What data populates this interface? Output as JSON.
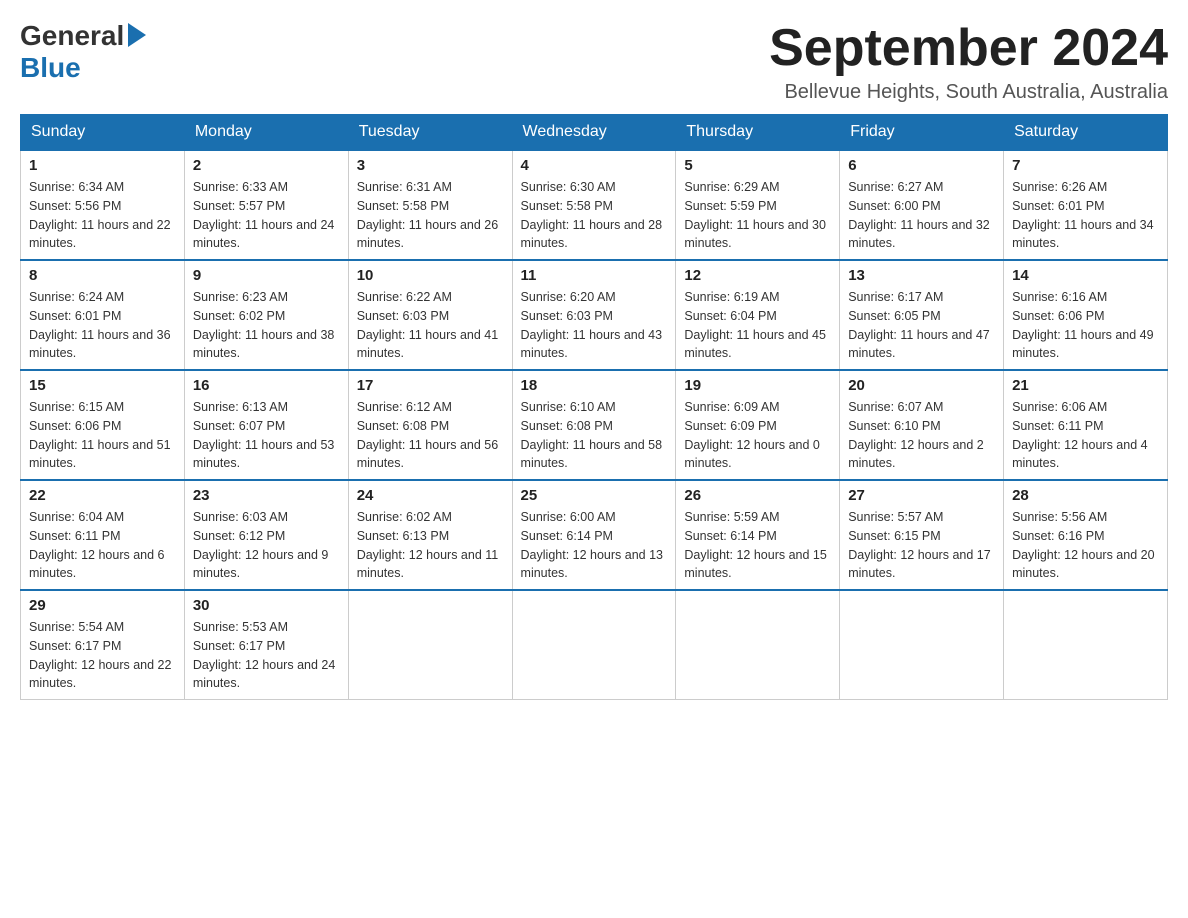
{
  "logo": {
    "general": "General",
    "blue": "Blue"
  },
  "header": {
    "month": "September 2024",
    "location": "Bellevue Heights, South Australia, Australia"
  },
  "weekdays": [
    "Sunday",
    "Monday",
    "Tuesday",
    "Wednesday",
    "Thursday",
    "Friday",
    "Saturday"
  ],
  "weeks": [
    [
      {
        "day": "1",
        "sunrise": "6:34 AM",
        "sunset": "5:56 PM",
        "daylight": "11 hours and 22 minutes."
      },
      {
        "day": "2",
        "sunrise": "6:33 AM",
        "sunset": "5:57 PM",
        "daylight": "11 hours and 24 minutes."
      },
      {
        "day": "3",
        "sunrise": "6:31 AM",
        "sunset": "5:58 PM",
        "daylight": "11 hours and 26 minutes."
      },
      {
        "day": "4",
        "sunrise": "6:30 AM",
        "sunset": "5:58 PM",
        "daylight": "11 hours and 28 minutes."
      },
      {
        "day": "5",
        "sunrise": "6:29 AM",
        "sunset": "5:59 PM",
        "daylight": "11 hours and 30 minutes."
      },
      {
        "day": "6",
        "sunrise": "6:27 AM",
        "sunset": "6:00 PM",
        "daylight": "11 hours and 32 minutes."
      },
      {
        "day": "7",
        "sunrise": "6:26 AM",
        "sunset": "6:01 PM",
        "daylight": "11 hours and 34 minutes."
      }
    ],
    [
      {
        "day": "8",
        "sunrise": "6:24 AM",
        "sunset": "6:01 PM",
        "daylight": "11 hours and 36 minutes."
      },
      {
        "day": "9",
        "sunrise": "6:23 AM",
        "sunset": "6:02 PM",
        "daylight": "11 hours and 38 minutes."
      },
      {
        "day": "10",
        "sunrise": "6:22 AM",
        "sunset": "6:03 PM",
        "daylight": "11 hours and 41 minutes."
      },
      {
        "day": "11",
        "sunrise": "6:20 AM",
        "sunset": "6:03 PM",
        "daylight": "11 hours and 43 minutes."
      },
      {
        "day": "12",
        "sunrise": "6:19 AM",
        "sunset": "6:04 PM",
        "daylight": "11 hours and 45 minutes."
      },
      {
        "day": "13",
        "sunrise": "6:17 AM",
        "sunset": "6:05 PM",
        "daylight": "11 hours and 47 minutes."
      },
      {
        "day": "14",
        "sunrise": "6:16 AM",
        "sunset": "6:06 PM",
        "daylight": "11 hours and 49 minutes."
      }
    ],
    [
      {
        "day": "15",
        "sunrise": "6:15 AM",
        "sunset": "6:06 PM",
        "daylight": "11 hours and 51 minutes."
      },
      {
        "day": "16",
        "sunrise": "6:13 AM",
        "sunset": "6:07 PM",
        "daylight": "11 hours and 53 minutes."
      },
      {
        "day": "17",
        "sunrise": "6:12 AM",
        "sunset": "6:08 PM",
        "daylight": "11 hours and 56 minutes."
      },
      {
        "day": "18",
        "sunrise": "6:10 AM",
        "sunset": "6:08 PM",
        "daylight": "11 hours and 58 minutes."
      },
      {
        "day": "19",
        "sunrise": "6:09 AM",
        "sunset": "6:09 PM",
        "daylight": "12 hours and 0 minutes."
      },
      {
        "day": "20",
        "sunrise": "6:07 AM",
        "sunset": "6:10 PM",
        "daylight": "12 hours and 2 minutes."
      },
      {
        "day": "21",
        "sunrise": "6:06 AM",
        "sunset": "6:11 PM",
        "daylight": "12 hours and 4 minutes."
      }
    ],
    [
      {
        "day": "22",
        "sunrise": "6:04 AM",
        "sunset": "6:11 PM",
        "daylight": "12 hours and 6 minutes."
      },
      {
        "day": "23",
        "sunrise": "6:03 AM",
        "sunset": "6:12 PM",
        "daylight": "12 hours and 9 minutes."
      },
      {
        "day": "24",
        "sunrise": "6:02 AM",
        "sunset": "6:13 PM",
        "daylight": "12 hours and 11 minutes."
      },
      {
        "day": "25",
        "sunrise": "6:00 AM",
        "sunset": "6:14 PM",
        "daylight": "12 hours and 13 minutes."
      },
      {
        "day": "26",
        "sunrise": "5:59 AM",
        "sunset": "6:14 PM",
        "daylight": "12 hours and 15 minutes."
      },
      {
        "day": "27",
        "sunrise": "5:57 AM",
        "sunset": "6:15 PM",
        "daylight": "12 hours and 17 minutes."
      },
      {
        "day": "28",
        "sunrise": "5:56 AM",
        "sunset": "6:16 PM",
        "daylight": "12 hours and 20 minutes."
      }
    ],
    [
      {
        "day": "29",
        "sunrise": "5:54 AM",
        "sunset": "6:17 PM",
        "daylight": "12 hours and 22 minutes."
      },
      {
        "day": "30",
        "sunrise": "5:53 AM",
        "sunset": "6:17 PM",
        "daylight": "12 hours and 24 minutes."
      },
      null,
      null,
      null,
      null,
      null
    ]
  ],
  "labels": {
    "sunrise": "Sunrise: ",
    "sunset": "Sunset: ",
    "daylight": "Daylight: "
  }
}
